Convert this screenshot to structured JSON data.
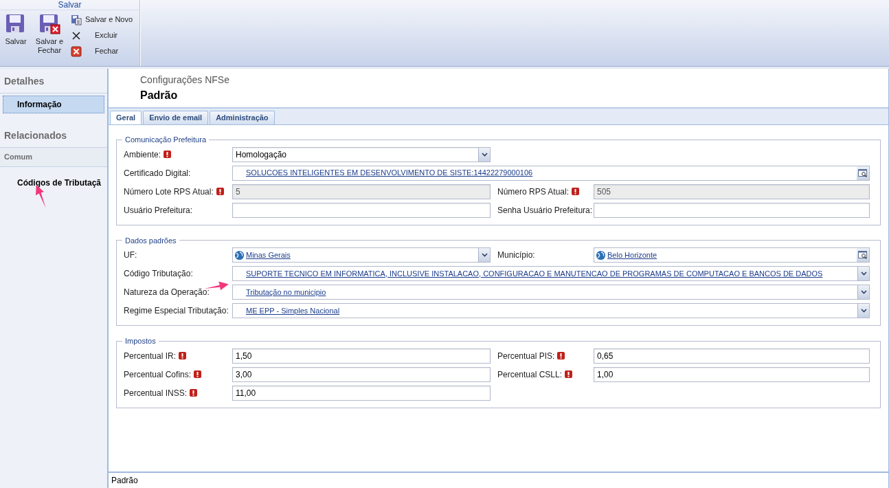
{
  "toolbar": {
    "group_title": "Salvar",
    "large_buttons": [
      {
        "label": "Salvar",
        "kind": "save"
      },
      {
        "label": "Salvar e Fechar",
        "kind": "save-close"
      }
    ],
    "small_buttons": [
      {
        "label": "Salvar e Novo",
        "kind": "save-new"
      },
      {
        "label": "Excluir",
        "kind": "delete"
      },
      {
        "label": "Fechar",
        "kind": "close"
      }
    ]
  },
  "sidebar": {
    "sections": [
      {
        "title": "Detalhes",
        "items": [
          {
            "label": "Informação",
            "selected": true
          }
        ]
      },
      {
        "title": "Relacionados",
        "subtitle": "Comum",
        "items": [
          {
            "label": "Códigos de Tributaçã",
            "selected": false
          }
        ]
      }
    ]
  },
  "header": {
    "entity": "Configurações NFSe",
    "title": "Padrão"
  },
  "tabs": [
    {
      "label": "Geral",
      "selected": true
    },
    {
      "label": "Envio de email",
      "selected": false
    },
    {
      "label": "Administração",
      "selected": false
    }
  ],
  "sections": [
    {
      "legend": "Comunicação Prefeitura",
      "rows": [
        [
          {
            "label": "Ambiente:",
            "required": true,
            "kind": "dropdown",
            "value": "Homologação",
            "globe": false,
            "disabled": false
          }
        ],
        [
          {
            "label": "Certificado Digital:",
            "required": false,
            "kind": "lookup",
            "value": "SOLUCOES INTELIGENTES EM DESENVOLVIMENTO DE SISTE:14422279000106",
            "globe": false,
            "disabled": false,
            "wide": true
          }
        ],
        [
          {
            "label": "Número Lote RPS Atual:",
            "required": true,
            "kind": "text",
            "value": "5",
            "globe": false,
            "disabled": true
          },
          {
            "label": "Número RPS Atual:",
            "required": true,
            "kind": "text",
            "value": "505",
            "globe": false,
            "disabled": true
          }
        ],
        [
          {
            "label": "Usuário Prefeitura:",
            "required": false,
            "kind": "text",
            "globe": false,
            "disabled": false
          },
          {
            "label": "Senha Usuário Prefeitura:",
            "required": false,
            "kind": "text",
            "globe": false,
            "disabled": false
          }
        ]
      ]
    },
    {
      "legend": "Dados padrões",
      "rows": [
        [
          {
            "label": "UF:",
            "required": false,
            "kind": "link-dropdown",
            "value": "Minas Gerais",
            "globe": true,
            "disabled": false
          },
          {
            "label": "Município:",
            "required": false,
            "kind": "lookup",
            "value": "Belo Horizonte",
            "globe": true,
            "disabled": false
          }
        ],
        [
          {
            "label": "Código Tributação:",
            "required": false,
            "kind": "link-dropdown",
            "value": "SUPORTE TECNICO EM INFORMATICA, INCLUSIVE INSTALACAO, CONFIGURACAO E MANUTENCAO DE PROGRAMAS DE COMPUTACAO E BANCOS DE DADOS",
            "globe": false,
            "disabled": false,
            "wide": true
          }
        ],
        [
          {
            "label": "Natureza da Operação:",
            "required": false,
            "kind": "link-dropdown",
            "value": "Tributação no municipio",
            "globe": false,
            "disabled": false,
            "wide": true
          }
        ],
        [
          {
            "label": "Regime Especial Tributação:",
            "required": false,
            "kind": "link-dropdown",
            "value": "ME EPP - Simples Nacional",
            "globe": false,
            "disabled": false,
            "wide": true
          }
        ]
      ]
    },
    {
      "legend": "Impostos",
      "rows": [
        [
          {
            "label": "Percentual IR:",
            "required": true,
            "kind": "text",
            "value": "1,50",
            "globe": false,
            "disabled": false
          },
          {
            "label": "Percentual PIS:",
            "required": true,
            "kind": "text",
            "value": "0,65",
            "globe": false,
            "disabled": false
          }
        ],
        [
          {
            "label": "Percentual Cofins:",
            "required": true,
            "kind": "text",
            "value": "3,00",
            "globe": false,
            "disabled": false
          },
          {
            "label": "Percentual CSLL:",
            "required": true,
            "kind": "text",
            "value": "1,00",
            "globe": false,
            "disabled": false
          }
        ],
        [
          {
            "label": "Percentual INSS:",
            "required": true,
            "kind": "text",
            "value": "11,00",
            "globe": false,
            "disabled": false
          }
        ]
      ]
    }
  ],
  "status_bar": {
    "text": "Padrão"
  }
}
